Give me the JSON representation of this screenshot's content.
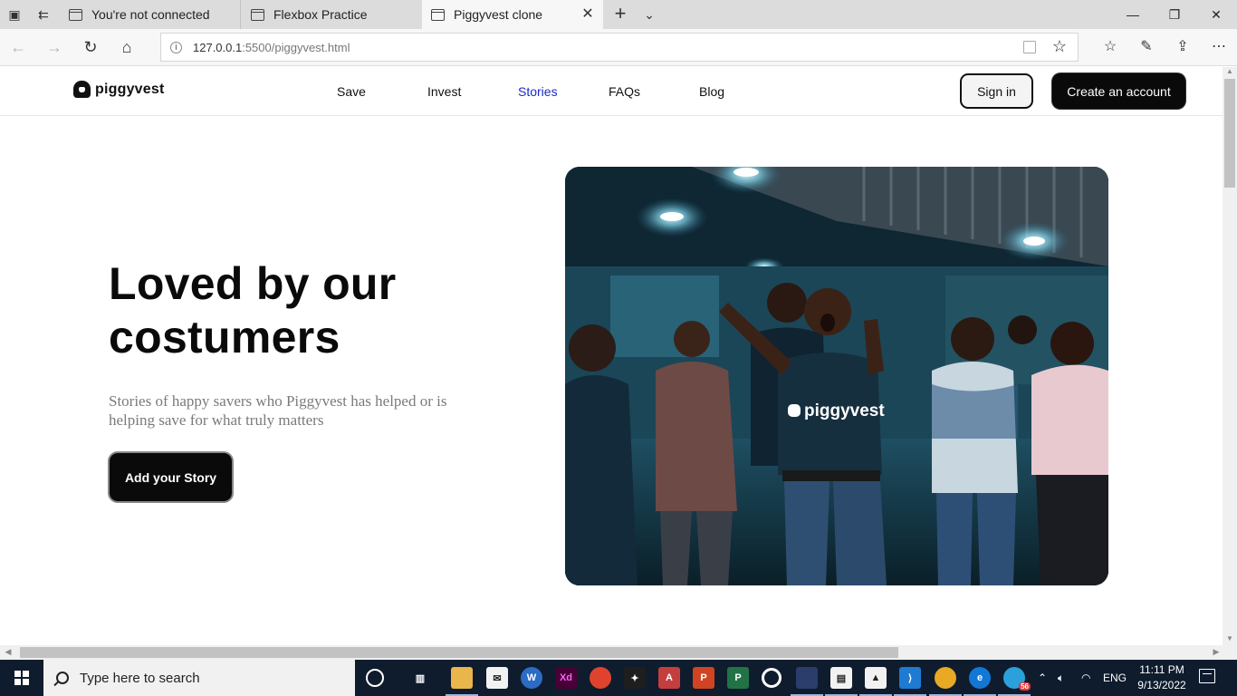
{
  "browser": {
    "tabs": [
      {
        "title": "You're not connected"
      },
      {
        "title": "Flexbox Practice"
      },
      {
        "title": "Piggyvest clone"
      }
    ],
    "address": {
      "host": "127.0.0.1",
      "path": ":5500/piggyvest.html"
    }
  },
  "site": {
    "logo_text": "piggyvest",
    "nav": [
      "Save",
      "Invest",
      "Stories",
      "FAQs",
      "Blog"
    ],
    "active_nav": "Stories",
    "sign_in": "Sign in",
    "create_account": "Create an account"
  },
  "hero": {
    "title": "Loved by our costumers",
    "subtitle": "Stories of happy savers who Piggyvest has helped or is helping save for what truly matters",
    "cta": "Add your Story",
    "photo_shirt_text": "piggyvest"
  },
  "taskbar": {
    "search_placeholder": "Type here to search",
    "language": "ENG",
    "time": "11:11 PM",
    "date": "9/13/2022",
    "badge": "56"
  }
}
